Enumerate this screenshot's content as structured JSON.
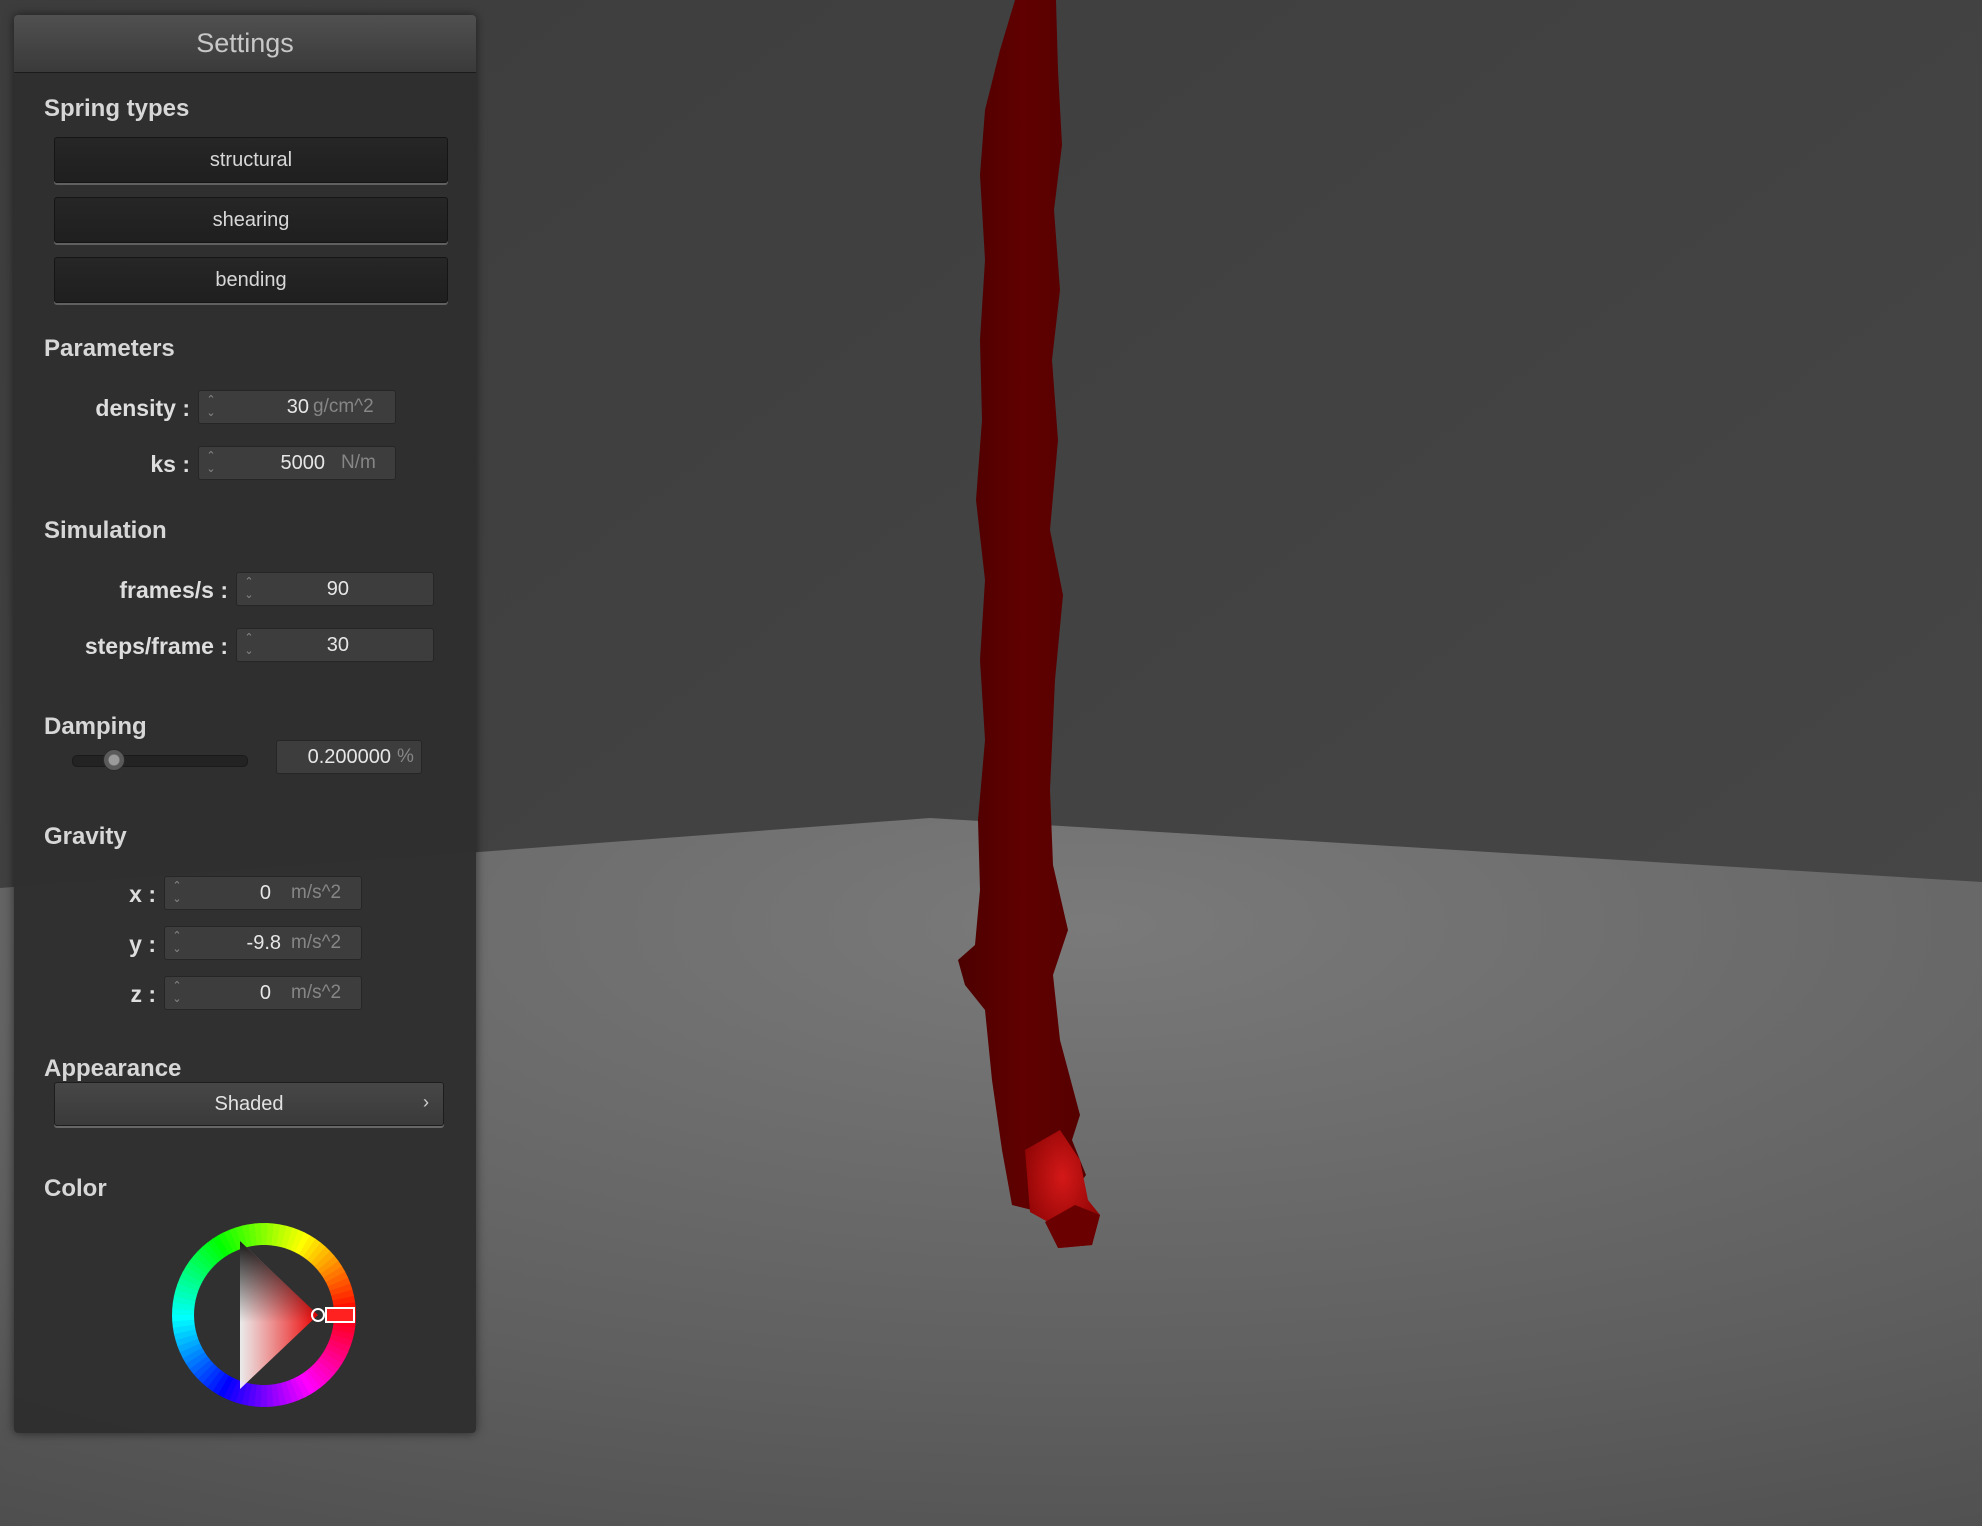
{
  "panel": {
    "title": "Settings",
    "spring_types": {
      "heading": "Spring types",
      "buttons": [
        "structural",
        "shearing",
        "bending"
      ]
    },
    "parameters": {
      "heading": "Parameters",
      "density": {
        "label": "density :",
        "value": "30",
        "unit": "g/cm^2"
      },
      "ks": {
        "label": "ks :",
        "value": "5000",
        "unit": "N/m"
      }
    },
    "simulation": {
      "heading": "Simulation",
      "fps": {
        "label": "frames/s :",
        "value": "90"
      },
      "steps": {
        "label": "steps/frame :",
        "value": "30"
      }
    },
    "damping": {
      "heading": "Damping",
      "value": "0.200000",
      "unit": "%",
      "slider_fraction": 0.2
    },
    "gravity": {
      "heading": "Gravity",
      "x": {
        "label": "x :",
        "value": "0",
        "unit": "m/s^2"
      },
      "y": {
        "label": "y :",
        "value": "-9.8",
        "unit": "m/s^2"
      },
      "z": {
        "label": "z :",
        "value": "0",
        "unit": "m/s^2"
      }
    },
    "appearance": {
      "heading": "Appearance",
      "selected": "Shaded",
      "arrow_icon": "chevron-right-icon"
    },
    "color": {
      "heading": "Color",
      "selected_hex": "#cc0000"
    }
  },
  "scene": {
    "wall_color": "#434343",
    "floor_color": "#6a6a6a",
    "cloth_color": "#5e0000",
    "cloth_highlight_color": "#c41010"
  }
}
